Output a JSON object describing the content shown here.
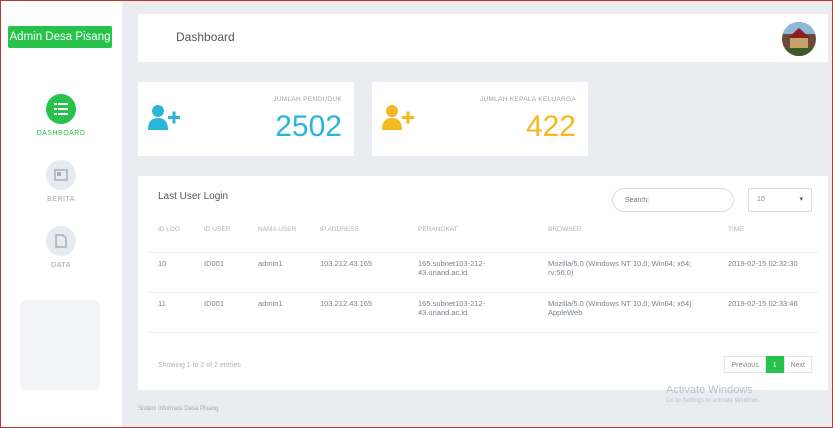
{
  "app": {
    "brand": "Admin Desa Pisang",
    "page_title": "Dashboard",
    "footer": "Sistem Informasi Desa Pisang"
  },
  "sidebar": {
    "items": [
      {
        "label": "DASHBOARD",
        "icon": "list-icon",
        "active": true
      },
      {
        "label": "BERITA",
        "icon": "news-icon",
        "active": false
      },
      {
        "label": "DATA",
        "icon": "document-icon",
        "active": false
      }
    ]
  },
  "stats": [
    {
      "label": "JUMLAH PENDUDUK",
      "value": "2502",
      "icon": "add-user-icon",
      "color": "#29b6d8"
    },
    {
      "label": "JUMLAH KEPALA KELUARGA",
      "value": "422",
      "icon": "add-user-icon",
      "color": "#f5b91f"
    }
  ],
  "login_table": {
    "title": "Last User Login",
    "search_placeholder": "Search:",
    "page_size": "10",
    "columns": [
      "ID LOG",
      "ID USER",
      "NAMA USER",
      "IP ADDRESS",
      "PERANGKAT",
      "BROWSER",
      "TIME"
    ],
    "rows": [
      [
        "10",
        "ID001",
        "admin1",
        "103.212.43.165",
        "165.subnet103-212-43.unand.ac.id",
        "Mozilla/5.0 (Windows NT 10.0; Win64; x64; rv:56.0)",
        "2019-02-15 02:32:30"
      ],
      [
        "11",
        "ID001",
        "admin1",
        "103.212.43.165",
        "165.subnet103-212-43.unand.ac.id",
        "Mozilla/5.0 (Windows NT 10.0; Win64; x64) AppleWeb",
        "2019-02-15 02:33:46"
      ]
    ],
    "showing": "Showing 1 to 2 of 2 entries",
    "pagination": {
      "previous": "Previous",
      "current": "1",
      "next": "Next"
    }
  },
  "watermark": {
    "title": "Activate Windows",
    "subtitle": "Go to Settings to activate Windows."
  },
  "colors": {
    "accent_green": "#27c24c",
    "cyan": "#29b6d8",
    "amber": "#f5b91f",
    "background": "#e9edf2"
  }
}
